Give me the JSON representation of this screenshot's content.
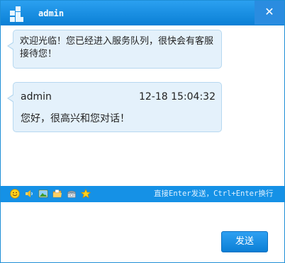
{
  "window": {
    "title": "admin",
    "close_label": "✕"
  },
  "messages": {
    "system": {
      "text": "欢迎光临！您已经进入服务队列，很快会有客服接待您！"
    },
    "chat": {
      "sender": "admin",
      "time": "12-18 15:04:32",
      "text": "您好，很高兴和您对话！"
    }
  },
  "toolbar": {
    "icons": [
      "smiley-icon",
      "volume-icon",
      "image-icon",
      "folder-icon",
      "phone-icon",
      "star-icon"
    ],
    "hint": "直接Enter发送，Ctrl+Enter换行"
  },
  "composer": {
    "send_label": "发送"
  },
  "colors": {
    "accent": "#1591e6",
    "bubble": "#e4f1fb"
  }
}
